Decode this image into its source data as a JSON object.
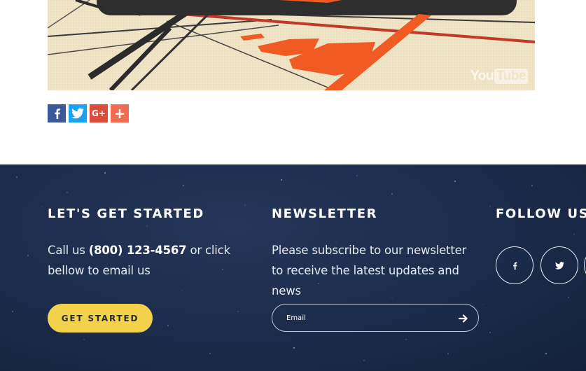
{
  "video": {
    "logo_you": "You",
    "logo_tube": "Tube",
    "colors": {
      "background": "#efe4c6",
      "accent": "#f05a23",
      "dark": "#2b2b2b"
    }
  },
  "share": {
    "buttons": [
      {
        "name": "facebook",
        "icon": "facebook-icon",
        "color": "#3b5998"
      },
      {
        "name": "twitter",
        "icon": "twitter-icon",
        "color": "#1da1f2"
      },
      {
        "name": "google-plus",
        "icon": "google-plus-icon",
        "label": "G+",
        "color": "#dd4b39"
      },
      {
        "name": "more",
        "icon": "plus-icon",
        "label": "+",
        "color": "#f26c4f"
      }
    ]
  },
  "footer": {
    "colors": {
      "background": "#1b2b4b",
      "button": "#f2d24b"
    },
    "get_started": {
      "heading": "LET'S GET STARTED",
      "text_before": "Call us ",
      "phone": "(800) 123-4567",
      "text_after": " or click bellow to email us",
      "button_label": "GET STARTED"
    },
    "newsletter": {
      "heading": "NEWSLETTER",
      "text": "Please subscribe to our newsletter to receive the latest updates and news",
      "email_placeholder": "Email",
      "submit_icon": "arrow-right-icon"
    },
    "follow": {
      "heading": "FOLLOW US",
      "links": [
        {
          "name": "facebook",
          "icon": "facebook-icon"
        },
        {
          "name": "twitter",
          "icon": "twitter-icon"
        },
        {
          "name": "more",
          "icon": "social-icon"
        }
      ]
    }
  }
}
